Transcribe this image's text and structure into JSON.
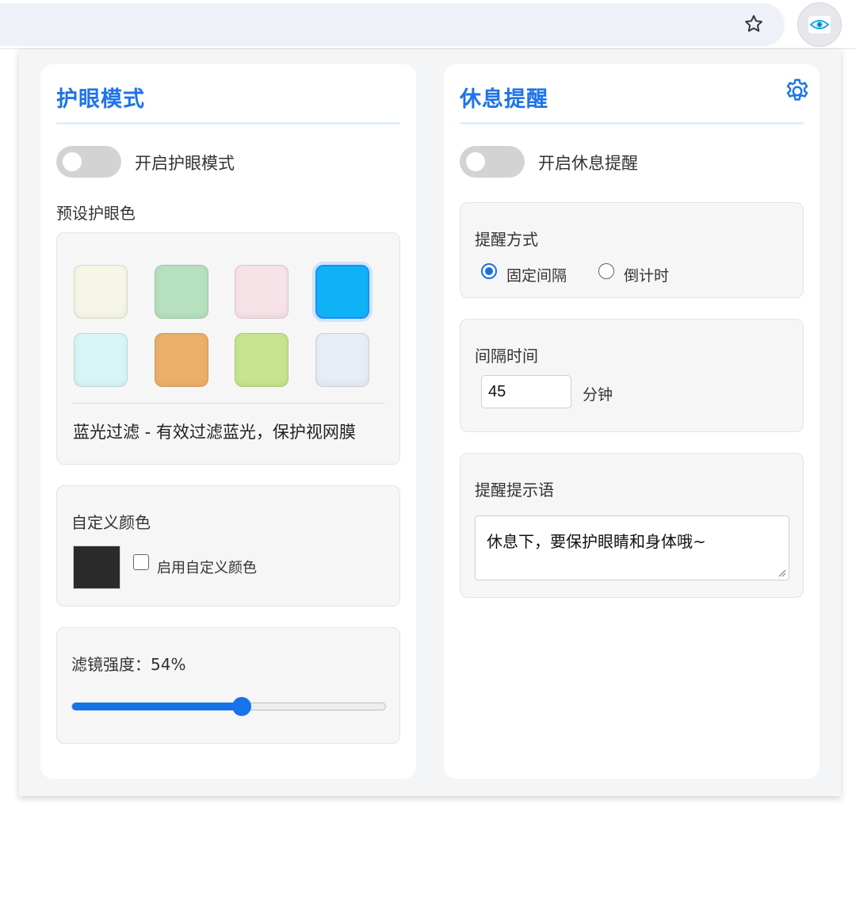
{
  "toolbar": {
    "star_icon": "star-outline-icon",
    "extension_icon": "eye-icon"
  },
  "eye_mode": {
    "title": "护眼模式",
    "toggle_label": "开启护眼模式",
    "toggle_on": false,
    "presets_heading": "预设护眼色",
    "swatches": [
      {
        "color": "#f6f6e6",
        "selected": false
      },
      {
        "color": "#b6e0be",
        "selected": false
      },
      {
        "color": "#f7e2e8",
        "selected": false
      },
      {
        "color": "#0fb2f5",
        "selected": true
      },
      {
        "color": "#d7f5f6",
        "selected": false
      },
      {
        "color": "#eab06a",
        "selected": false
      },
      {
        "color": "#c6e58e",
        "selected": false
      },
      {
        "color": "#e6edf4",
        "selected": false
      }
    ],
    "preset_description": "蓝光过滤 - 有效过滤蓝光，保护视网膜",
    "custom_color_heading": "自定义颜色",
    "custom_color_value": "#2b2b2b",
    "custom_color_checkbox_label": "启用自定义颜色",
    "custom_color_enabled": false,
    "filter_strength_label": "滤镜强度：54%",
    "filter_strength_percent": 54
  },
  "rest_reminder": {
    "title": "休息提醒",
    "settings_icon": "gear-icon",
    "toggle_label": "开启休息提醒",
    "toggle_on": false,
    "mode_heading": "提醒方式",
    "mode_options": [
      {
        "label": "固定间隔",
        "checked": true
      },
      {
        "label": "倒计时",
        "checked": false
      }
    ],
    "interval_heading": "间隔时间",
    "interval_value": "45",
    "interval_unit": "分钟",
    "message_heading": "提醒提示语",
    "message_value": "休息下，要保护眼睛和身体哦~"
  },
  "colors": {
    "accent": "#1e73e8",
    "slider": "#1773ea"
  }
}
